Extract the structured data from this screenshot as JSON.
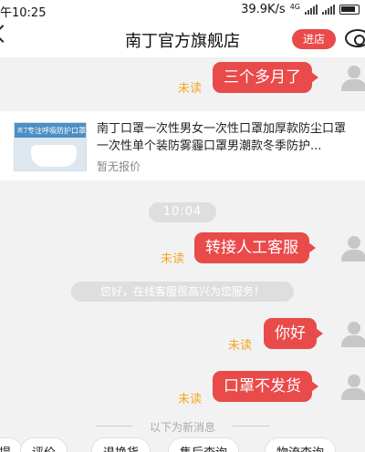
{
  "status_bar": {
    "time": "午10:25",
    "speed": "39.9K/s",
    "network": "4G"
  },
  "header": {
    "title": "南丁官方旗舰店",
    "shop_button": "进店"
  },
  "messages": [
    {
      "text": "三个多月了",
      "status": "未读"
    },
    {
      "text": "转接人工客服",
      "status": "未读"
    },
    {
      "text": "你好",
      "status": "未读"
    },
    {
      "text": "口罩不发货",
      "status": "未读"
    }
  ],
  "product_card": {
    "brand": "南丁",
    "image_caption": "专注呼吸防护口罩",
    "title": "南丁口罩一次性男女一次性口罩加厚款防尘口罩一次性单个装防雾霾口罩男潮款冬季防护...",
    "price": "暂无报价"
  },
  "time_divider": "10:04",
  "system_message": "您好，在线客服很高兴为您服务！",
  "new_messages_divider": "以下为新消息",
  "quick_actions": [
    "提",
    "评价",
    "退换货",
    "售后查询",
    "物流查询"
  ]
}
